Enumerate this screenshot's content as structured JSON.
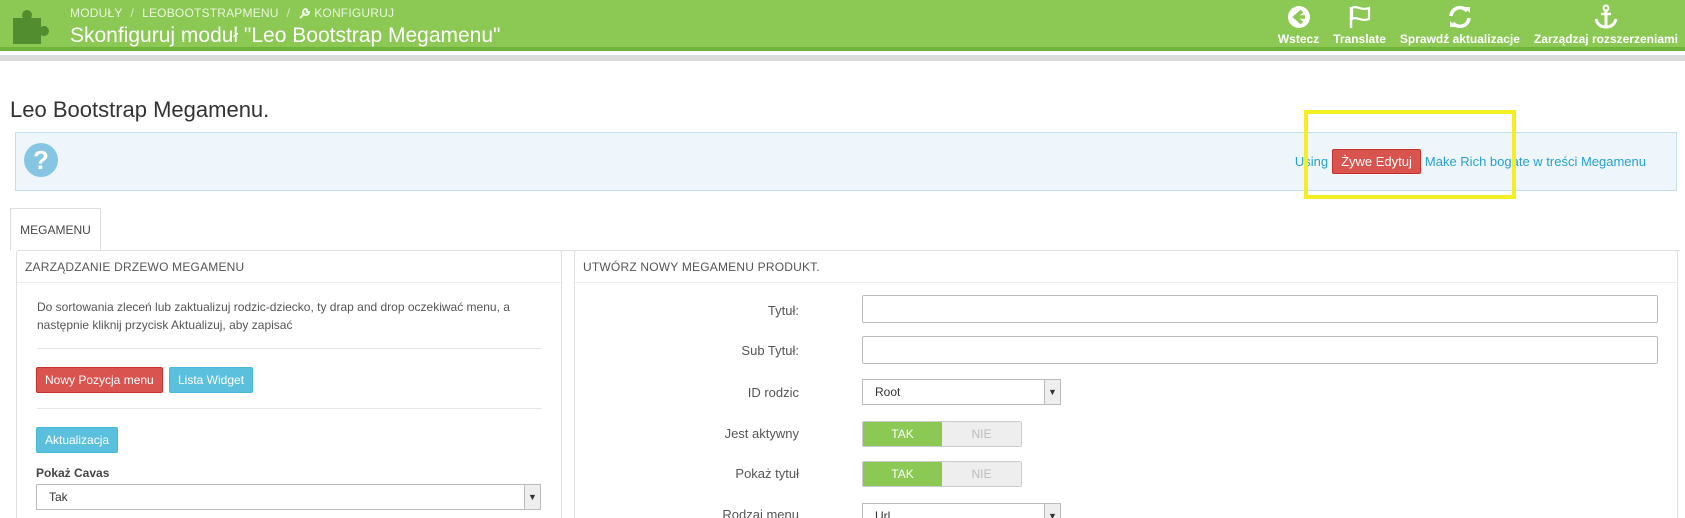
{
  "header": {
    "breadcrumb": [
      "MODUŁY",
      "LEOBOOTSTRAPMENU",
      "KONFIGURUJ"
    ],
    "title": "Skonfiguruj moduł \"Leo Bootstrap Megamenu\"",
    "toolbar": [
      {
        "label": "Wstecz",
        "icon": "back-arrow-icon"
      },
      {
        "label": "Translate",
        "icon": "flag-icon"
      },
      {
        "label": "Sprawdź aktualizacje",
        "icon": "refresh-icon"
      },
      {
        "label": "Zarządzaj rozszerzeniami",
        "icon": "anchor-icon"
      }
    ]
  },
  "main": {
    "heading": "Leo Bootstrap Megamenu.",
    "info": {
      "prefix": "Using",
      "button": "Żywe Edytuj",
      "suffix": "Make Rich bogate w treści Megamenu"
    },
    "tab": "MEGAMENU"
  },
  "left_panel": {
    "title": "ZARZĄDZANIE DRZEWO MEGAMENU",
    "description": "Do sortowania zleceń lub zaktualizuj rodzic-dziecko, ty drap and drop oczekiwać menu, a następnie kliknij przycisk Aktualizuj, aby zapisać",
    "new_item_button": "Nowy Pozycja menu",
    "widget_list_button": "Lista Widget",
    "update_button": "Aktualizacja",
    "show_canvas_label": "Pokaż Cavas",
    "show_canvas_value": "Tak"
  },
  "right_panel": {
    "title": "UTWÓRZ NOWY MEGAMENU PRODUKT.",
    "fields": {
      "title_label": "Tytuł:",
      "subtitle_label": "Sub Tytuł:",
      "parent_label": "ID rodzic",
      "parent_value": "Root",
      "active_label": "Jest aktywny",
      "show_title_label": "Pokaż tytuł",
      "menu_type_label": "Rodzaj menu",
      "menu_type_value": "Url",
      "yes": "TAK",
      "no": "NIE"
    }
  },
  "colors": {
    "header_green": "#8bc954",
    "highlight_yellow": "#f4ee26",
    "danger": "#d9534f",
    "info": "#5bc0de"
  }
}
